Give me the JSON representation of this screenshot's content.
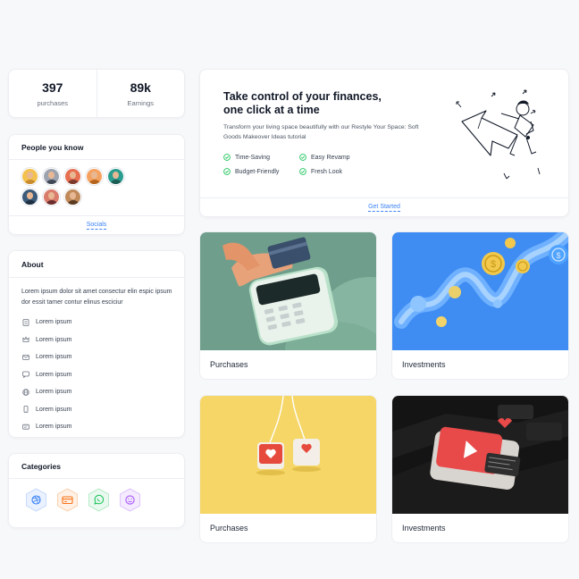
{
  "stats": [
    {
      "value": "397",
      "label": "purchases"
    },
    {
      "value": "89k",
      "label": "Earnings"
    }
  ],
  "people": {
    "title": "People you know",
    "link": "Socials",
    "avatars": [
      {
        "bg": "#f2c14e",
        "shirt": "#c98b2f"
      },
      {
        "bg": "#9ca3af",
        "shirt": "#3f4856"
      },
      {
        "bg": "#e76f51",
        "shirt": "#7a3b2e"
      },
      {
        "bg": "#f4a261",
        "shirt": "#b5651d"
      },
      {
        "bg": "#2a9d8f",
        "shirt": "#1d5c55"
      },
      {
        "bg": "#3b5b7a",
        "shirt": "#1f2f42"
      },
      {
        "bg": "#d97c6c",
        "shirt": "#6b2e2e"
      },
      {
        "bg": "#c08a5b",
        "shirt": "#5a3b22"
      }
    ]
  },
  "about": {
    "title": "About",
    "text": "Lorem ipsum dolor sit amet consectur elin espic ipsum dor essit tamer contur elinus esciciur",
    "items": [
      {
        "icon": "building-icon",
        "label": "Lorem ipsum"
      },
      {
        "icon": "crown-icon",
        "label": "Lorem ipsum"
      },
      {
        "icon": "mail-icon",
        "label": "Lorem ipsum"
      },
      {
        "icon": "chat-icon",
        "label": "Lorem ipsum"
      },
      {
        "icon": "globe-icon",
        "label": "Lorem ipsum"
      },
      {
        "icon": "phone-icon",
        "label": "Lorem ipsum"
      },
      {
        "icon": "message-icon",
        "label": "Lorem ipsum"
      }
    ]
  },
  "categories": {
    "title": "Categories",
    "items": [
      {
        "icon": "dribbble-icon",
        "color": "#3b82f6",
        "bg": "#eaf2ff"
      },
      {
        "icon": "card-icon",
        "color": "#f97316",
        "bg": "#fff1e6"
      },
      {
        "icon": "whatsapp-icon",
        "color": "#22c55e",
        "bg": "#e9f9ef"
      },
      {
        "icon": "smile-icon",
        "color": "#a855f7",
        "bg": "#f4ebff"
      }
    ]
  },
  "hero": {
    "title": "Take control of your finances, one click at a time",
    "subtitle": "Transform your living space beautifully with our Restyle Your Space: Soft Goods Makeover Ideas tutorial",
    "features": [
      "Time-Saving",
      "Easy Revamp",
      "Budget-Friendly",
      "Fresh Look"
    ],
    "cta": "Get Started"
  },
  "tiles": [
    {
      "label": "Purchases"
    },
    {
      "label": "Investments"
    },
    {
      "label": "Purchases"
    },
    {
      "label": "Investments"
    }
  ],
  "colors": {
    "accent": "#3b82f6",
    "check": "#22c55e",
    "page_bg": "#f7f8fa"
  }
}
